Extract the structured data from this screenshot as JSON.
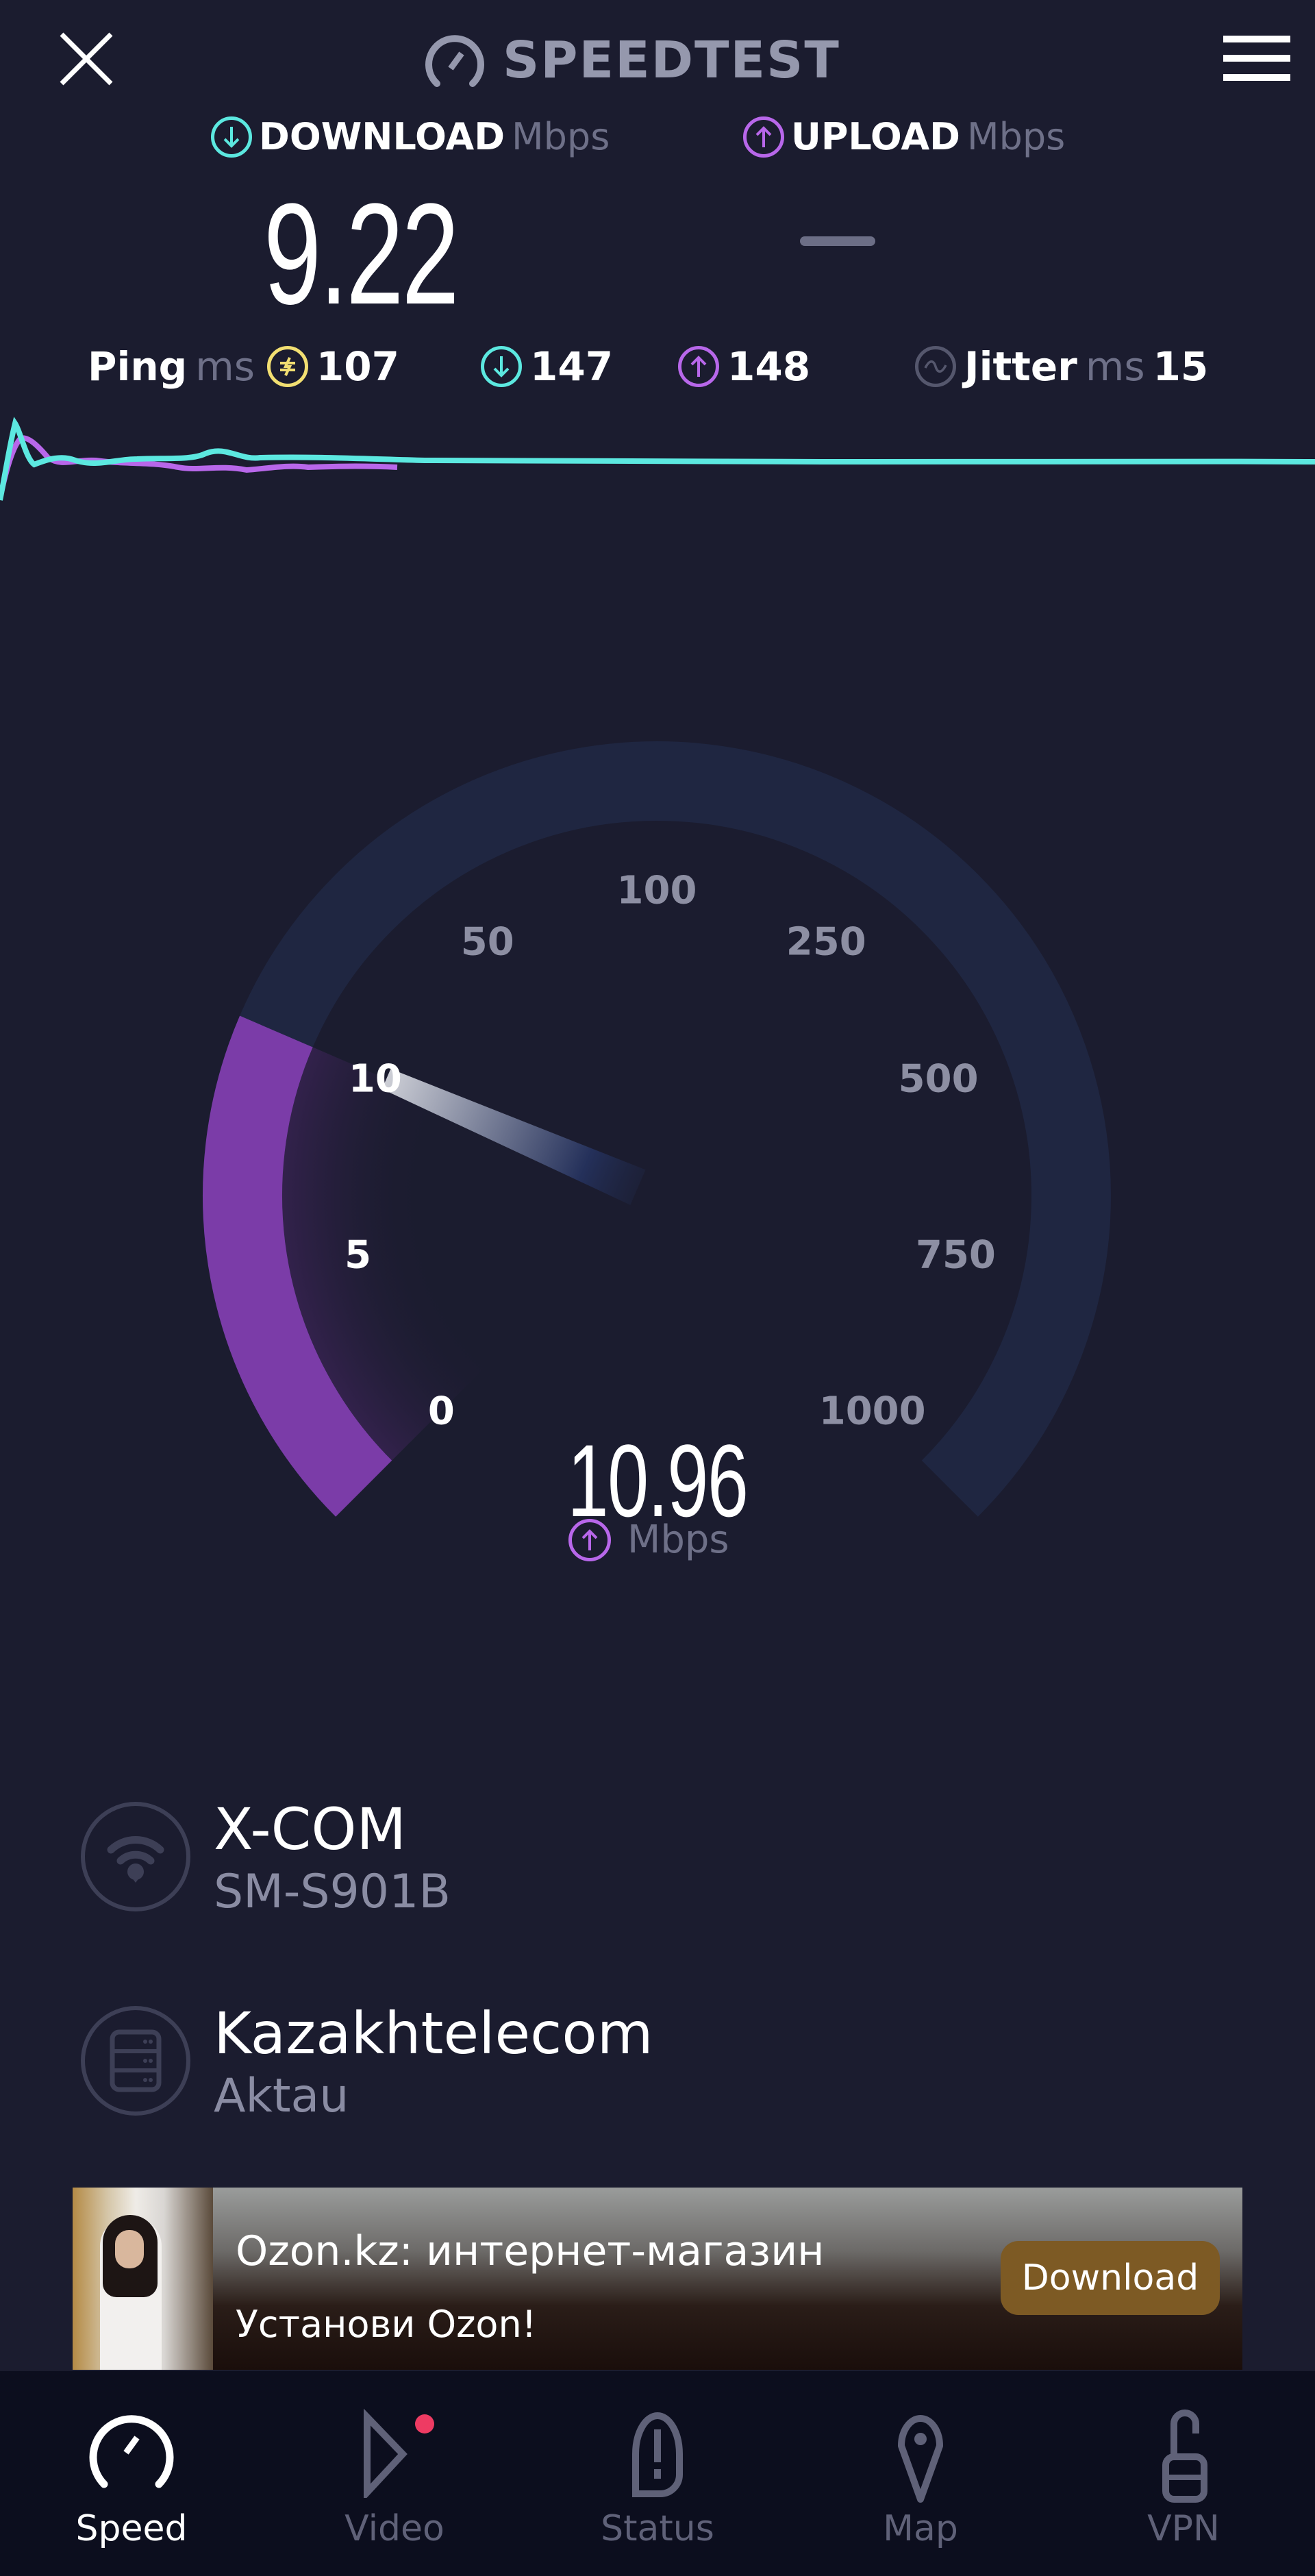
{
  "header": {
    "title": "SPEEDTEST",
    "close_icon": "close-icon",
    "menu_icon": "hamburger-menu-icon"
  },
  "results": {
    "download": {
      "label": "DOWNLOAD",
      "unit": "Mbps",
      "value": "9.22",
      "icon": "download-arrow-icon"
    },
    "upload": {
      "label": "UPLOAD",
      "unit": "Mbps",
      "value": "—",
      "icon": "upload-arrow-icon"
    }
  },
  "ping": {
    "label": "Ping",
    "unit": "ms",
    "idle": "107",
    "download": "147",
    "upload": "148"
  },
  "jitter": {
    "label": "Jitter",
    "unit": "ms",
    "value": "15"
  },
  "colors": {
    "background": "#1b1c2f",
    "download_accent": "#5ce8e0",
    "upload_accent": "#b867ea",
    "ping_accent": "#f2df72",
    "gauge_track": "#1f2641",
    "gauge_fill": "#7b3ca8"
  },
  "gauge": {
    "mode": "upload",
    "current_value": "10.96",
    "unit": "Mbps",
    "ticks": [
      "0",
      "5",
      "10",
      "50",
      "100",
      "250",
      "500",
      "750",
      "1000"
    ],
    "min": 0,
    "max": 1000
  },
  "connection": {
    "provider": "X-COM",
    "device": "SM-S901B",
    "server": "Kazakhtelecom",
    "server_location": "Aktau"
  },
  "ad": {
    "title": "Ozon.kz: интернет-магазин",
    "subtitle": "Установи Ozon!",
    "cta": "Download"
  },
  "nav": {
    "items": [
      {
        "label": "Speed",
        "icon": "speedometer-icon",
        "active": true
      },
      {
        "label": "Video",
        "icon": "play-icon",
        "badge": true
      },
      {
        "label": "Status",
        "icon": "alert-status-icon"
      },
      {
        "label": "Map",
        "icon": "map-pin-icon"
      },
      {
        "label": "VPN",
        "icon": "unlock-icon"
      }
    ]
  }
}
